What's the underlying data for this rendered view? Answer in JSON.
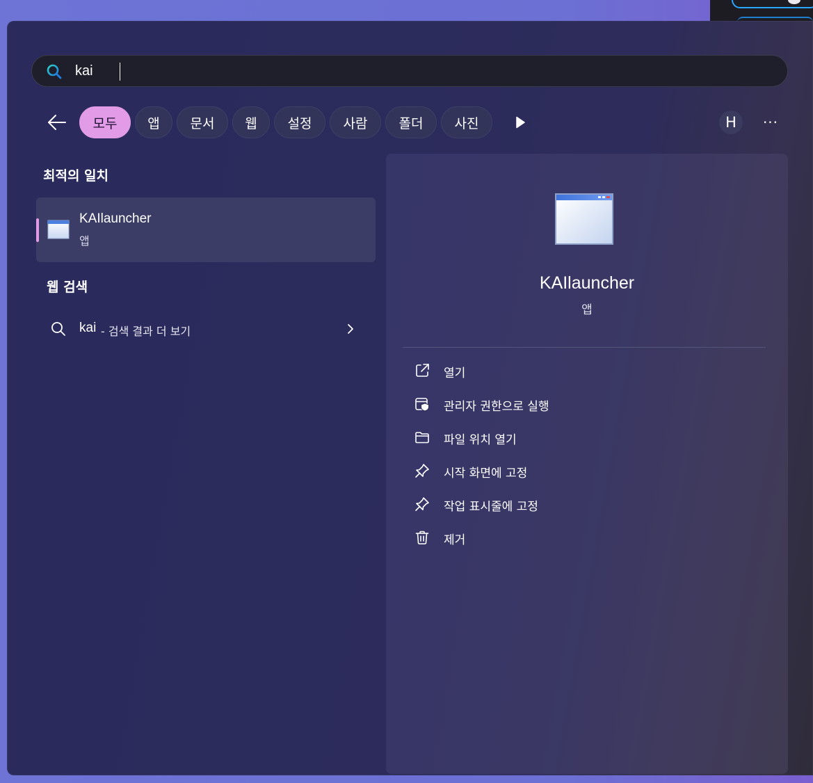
{
  "search": {
    "query": "kai"
  },
  "filters": {
    "back_label": "",
    "chips": [
      "모두",
      "앱",
      "문서",
      "웹",
      "설정",
      "사람",
      "폴더",
      "사진"
    ],
    "avatar_letter": "H",
    "more_label": "···"
  },
  "left": {
    "best_match_title": "최적의 일치",
    "best_match": {
      "name": "KAIlauncher",
      "type": "앱"
    },
    "web_search_title": "웹 검색",
    "web_search": {
      "query": "kai",
      "rest": "- 검색 결과 더 보기"
    }
  },
  "detail": {
    "name": "KAIlauncher",
    "type": "앱",
    "actions": [
      {
        "label": "열기",
        "icon": "open-external-icon"
      },
      {
        "label": "관리자 권한으로 실행",
        "icon": "admin-shield-icon"
      },
      {
        "label": "파일 위치 열기",
        "icon": "folder-icon"
      },
      {
        "label": "시작 화면에 고정",
        "icon": "pin-icon"
      },
      {
        "label": "작업 표시줄에 고정",
        "icon": "pin-icon"
      },
      {
        "label": "제거",
        "icon": "trash-icon"
      }
    ]
  },
  "colors": {
    "accent": "#e29be6",
    "panel": "#2a2b5c",
    "search_bg": "#1f1f2b"
  }
}
